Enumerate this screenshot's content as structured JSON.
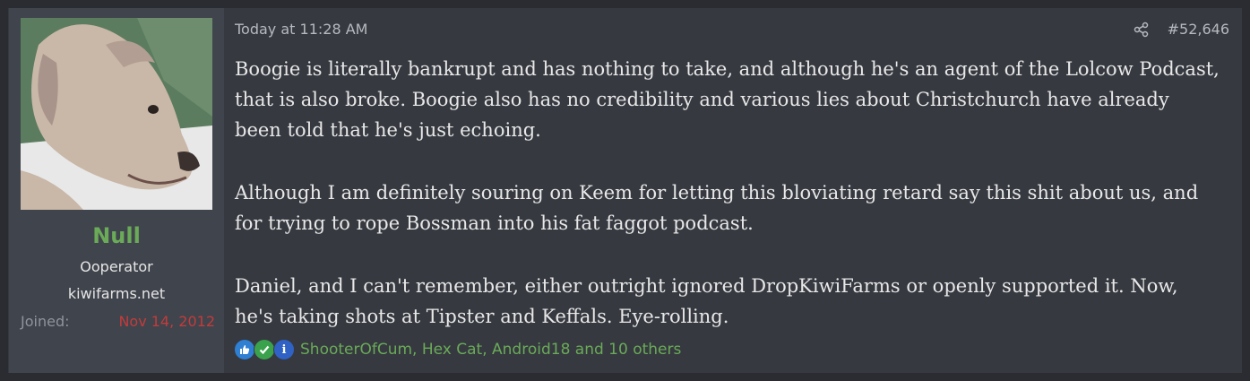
{
  "user": {
    "name": "Null",
    "title": "Ooperator",
    "banner": "kiwifarms.net",
    "joined_label": "Joined:",
    "joined_value": "Nov 14, 2012"
  },
  "post": {
    "date": "Today at 11:28 AM",
    "number": "#52,646",
    "share_icon": "share-icon",
    "paragraphs": [
      "Boogie is literally bankrupt and has nothing to take, and although he's an agent of the Lolcow Podcast, that is also broke. Boogie also has no credibility and various lies about Christchurch have already been told that he's just echoing.",
      "Although I am definitely souring on Keem for letting this bloviating retard say this shit about us, and for trying to rope Bossman into his fat faggot podcast.",
      "Daniel, and I can't remember, either outright ignored DropKiwiFarms or openly supported it. Now, he's taking shots at Tipster and Keffals. Eye-rolling."
    ]
  },
  "reactions": {
    "icons": [
      "like-icon",
      "check-icon",
      "info-icon"
    ],
    "text": "ShooterOfCum, Hex Cat, Android18 and 10 others"
  },
  "colors": {
    "username": "#6aaa58",
    "joined_value": "#c23c3c",
    "reaction_text": "#6aaa58"
  }
}
